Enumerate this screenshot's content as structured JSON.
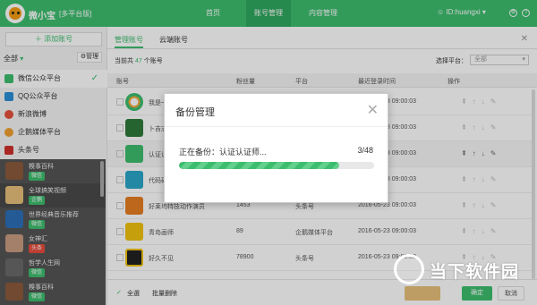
{
  "topbar": {
    "app_title": "微小宝",
    "app_subtitle": "[多平台版]",
    "nav": [
      "首页",
      "账号管理",
      "内容管理"
    ],
    "user": "ID:huangxi",
    "icons": [
      "settings-icon",
      "help-icon"
    ]
  },
  "sidebar": {
    "add_account": "添加账号",
    "filter_label": "全部",
    "manage_label": "管理",
    "platforms": [
      "微信公众平台",
      "QQ公众平台",
      "新浪微博",
      "企鹅媒体平台",
      "头条号"
    ],
    "accounts": [
      {
        "name": "糗事百科",
        "tag": "微信",
        "color": "#3dbd6e"
      },
      {
        "name": "全球搞笑视频",
        "tag": "企鹅",
        "color": "#3dbd6e"
      },
      {
        "name": "世界经典音乐推荐",
        "tag": "微信",
        "color": "#3dbd6e"
      },
      {
        "name": "女神汇",
        "tag": "头条",
        "color": "#e74c3c"
      },
      {
        "name": "哲学人生网",
        "tag": "微信",
        "color": "#3dbd6e"
      },
      {
        "name": "糗事百科",
        "tag": "微信",
        "color": "#3dbd6e"
      }
    ]
  },
  "main": {
    "tabs": [
      "管理账号",
      "云端账号"
    ],
    "count_prefix": "当前共",
    "count_value": "47",
    "count_suffix": "个账号",
    "select_platform_label": "选择平台：",
    "select_platform_value": "全部",
    "columns": [
      "账号",
      "粉丝量",
      "平台",
      "最近登录时间",
      "操作"
    ],
    "rows": [
      {
        "name": "我是一",
        "fans": "",
        "platform": "",
        "time": "2016-05-23 09:00:03"
      },
      {
        "name": "卜吉志",
        "fans": "",
        "platform": "",
        "time": "2016-05-23 09:00:03"
      },
      {
        "name": "认证认",
        "fans": "",
        "platform": "",
        "time": "2016-05-23 09:00:03"
      },
      {
        "name": "代码研",
        "fans": "",
        "platform": "",
        "time": "2016-05-23 09:00:03"
      },
      {
        "name": "好莱坞特技动作演员",
        "fans": "1453",
        "platform": "头条号",
        "time": "2016-05-23 09:00:03"
      },
      {
        "name": "青岛画师",
        "fans": "89",
        "platform": "企鹅媒体平台",
        "time": "2016-05-23 09:00:03"
      },
      {
        "name": "好久不见",
        "fans": "78900",
        "platform": "头条号",
        "time": "2016-05-23 09:00:03"
      }
    ],
    "footer": {
      "select_all": "全選",
      "batch_delete": "批量删除",
      "backup_btn": "",
      "confirm_btn": "确定",
      "cancel_btn": "取消"
    }
  },
  "modal": {
    "title": "备份管理",
    "progress_text": "正在备份：认证认证师...",
    "progress_count": "3/48",
    "progress_fraction": 0.82
  },
  "watermark": {
    "text": "当下软件园"
  }
}
